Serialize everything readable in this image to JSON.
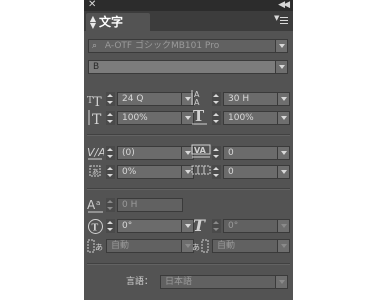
{
  "panel": {
    "close_icon": "close-icon",
    "collapse_icon": "double-chevron-icon",
    "tab_label": "文字",
    "menu_icon": "panel-menu-icon"
  },
  "font_family": {
    "value": "A-OTF ゴシックMB101 Pro",
    "icon": "search-icon"
  },
  "font_style": {
    "value": "B"
  },
  "font_size": {
    "value": "24 Q",
    "icon": "font-size-icon"
  },
  "leading": {
    "value": "30 H",
    "icon": "leading-icon"
  },
  "vertical_scale": {
    "value": "100%",
    "icon": "vertical-scale-icon"
  },
  "horizontal_scale": {
    "value": "100%",
    "icon": "horizontal-scale-icon"
  },
  "kerning": {
    "value": "(0)",
    "icon": "kerning-icon"
  },
  "tracking": {
    "value": "0",
    "icon": "tracking-icon"
  },
  "tsume": {
    "value": "0%",
    "icon": "tsume-icon"
  },
  "aki": {
    "value": "0",
    "icon": "aki-icon"
  },
  "baseline_shift": {
    "value": "0 H",
    "icon": "baseline-shift-icon"
  },
  "rotation": {
    "value": "0°",
    "icon": "rotate-icon"
  },
  "skew": {
    "value": "0°",
    "icon": "skew-icon"
  },
  "aki_before": {
    "value": "自動",
    "icon": "aki-before-icon"
  },
  "aki_after": {
    "value": "自動",
    "icon": "aki-after-icon"
  },
  "language": {
    "label": "言語：",
    "value": "日本語"
  },
  "colors": {
    "panel_bg": "#535353",
    "field_bg": "#6b6b6b",
    "titlebar": "#2c2c2c",
    "tabbar": "#3c3c3c"
  }
}
